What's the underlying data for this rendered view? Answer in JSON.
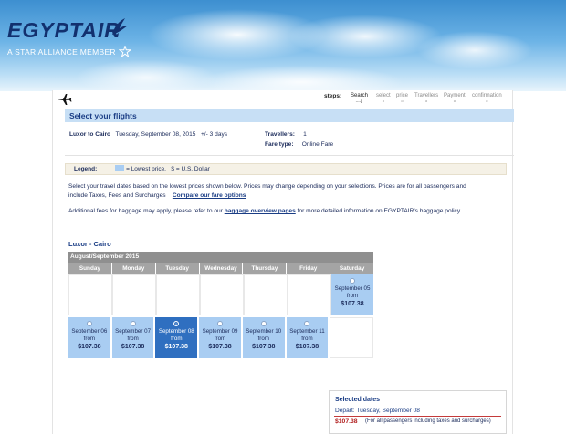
{
  "brand": {
    "logo_text": "EGYPTAIR",
    "tagline": "A STAR ALLIANCE MEMBER",
    "icons": [
      "horus-bird-icon",
      "star-alliance-icon"
    ]
  },
  "steps": {
    "label": "steps:",
    "items": [
      {
        "label": "Search",
        "marker": "----[]"
      },
      {
        "label": "select",
        "marker": "o"
      },
      {
        "label": "price",
        "marker": "o"
      },
      {
        "label": "Travellers",
        "marker": "o"
      },
      {
        "label": "Payment",
        "marker": "o"
      },
      {
        "label": "confirmation",
        "marker": "o"
      }
    ]
  },
  "page_title": "Select your flights",
  "trip": {
    "route": "Luxor to Cairo",
    "date": "Tuesday, September 08, 2015",
    "flex": "+/- 3 days",
    "travellers_label": "Travellers:",
    "travellers_value": "1",
    "fare_type_label": "Fare type:",
    "fare_type_value": "Online Fare"
  },
  "legend": {
    "label": "Legend:",
    "lowest_price": "= Lowest price,",
    "currency": "$  = U.S. Dollar",
    "swatch_color": "#a9cdf2"
  },
  "info": {
    "line1": "Select your travel dates based on the lowest prices shown below. Prices may change depending on your selections. Prices are for all passengers and",
    "line2": "include Taxes, Fees and Surcharges",
    "compare_link": "Compare our fare options",
    "baggage_pre": "Additional fees for baggage may apply, please refer to our",
    "baggage_link": "baggage overview pages",
    "baggage_post": "for more detailed information on EGYPTAIR's baggage policy."
  },
  "calendar": {
    "route_title": "Luxor - Cairo",
    "month_header": "August/September 2015",
    "weekdays": [
      "Sunday",
      "Monday",
      "Tuesday",
      "Wednesday",
      "Thursday",
      "Friday",
      "Saturday"
    ],
    "from_label": "from",
    "week1": {
      "saturday": {
        "date": "September 05",
        "price": "$107.38"
      }
    },
    "week2": [
      {
        "date": "September 06",
        "price": "$107.38"
      },
      {
        "date": "September 07",
        "price": "$107.38"
      },
      {
        "date": "September 08",
        "price": "$107.38",
        "selected": true
      },
      {
        "date": "September 09",
        "price": "$107.38"
      },
      {
        "date": "September 10",
        "price": "$107.38"
      },
      {
        "date": "September 11",
        "price": "$107.38"
      }
    ]
  },
  "summary": {
    "title": "Selected dates",
    "depart": "Depart: Tuesday, September 08",
    "price": "$107.38",
    "note": "(For all passengers including taxes and surcharges)"
  }
}
